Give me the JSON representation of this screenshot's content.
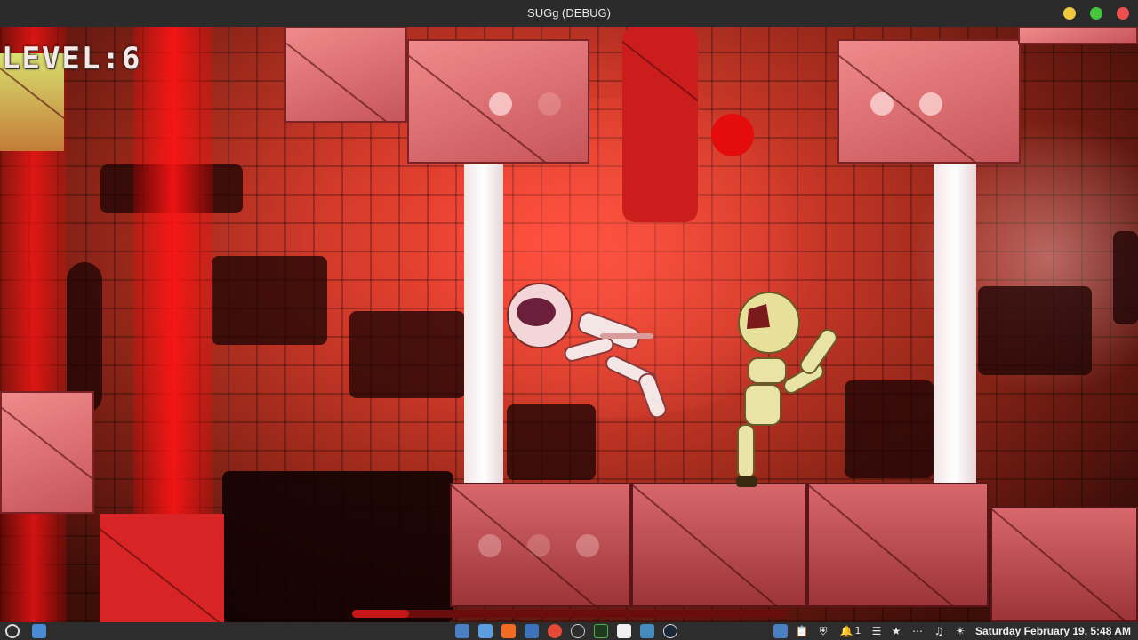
{
  "window": {
    "title": "SUGg (DEBUG)"
  },
  "hud": {
    "level_text": "LEVEL:6",
    "player_health_fraction": 0.13
  },
  "taskbar": {
    "left_icons": [
      "menu-icon",
      "file-manager-icon"
    ],
    "center_icons": [
      "screenshot-icon",
      "folder-icon",
      "brave-browser-icon",
      "screenshot-tool-icon",
      "chrome-icon",
      "disc-icon",
      "terminal-icon",
      "music-app-icon",
      "godot-icon",
      "steam-icon"
    ],
    "tray": {
      "notification_count": "1",
      "clock": "Saturday February 19,  5:48 AM"
    }
  },
  "colors": {
    "titlebar": "#2b2b2b",
    "taskbar": "#2d2d2d",
    "laser": "#ff1414",
    "block": "#e07478",
    "enemy_ragdoll": "#f2dede",
    "player_robot": "#e8e2a0"
  }
}
